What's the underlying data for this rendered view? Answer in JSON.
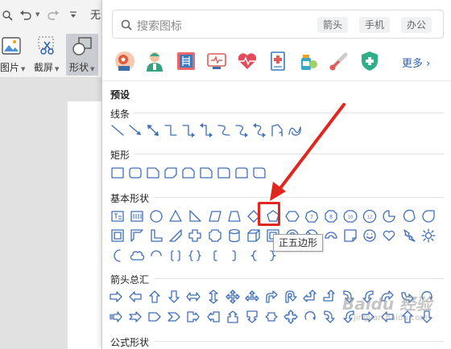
{
  "toolbar": {
    "picture_label": "图片",
    "screenshot_label": "截屏",
    "shapes_label": "形状"
  },
  "search": {
    "placeholder": "搜索图标",
    "tags": [
      "箭头",
      "手机",
      "办公"
    ]
  },
  "featured": {
    "icons": [
      "brain-gear-icon",
      "doctor-icon",
      "xray-icon",
      "medical-monitor-icon",
      "heart-pulse-icon",
      "medical-report-icon",
      "medicine-bottle-icon",
      "thermometer-icon",
      "health-shield-icon"
    ],
    "more_label": "更多"
  },
  "sections": {
    "preset": "预设",
    "lines": "线条",
    "rectangles": "矩形",
    "basic": "基本形状",
    "arrows": "箭头总汇",
    "formula": "公式形状"
  },
  "tooltip": "正五边形",
  "watermark": {
    "text": "Baidu 经验",
    "url": "jingyan.baidu.com"
  },
  "colors": {
    "shape_stroke": "#3f6fb7",
    "highlight": "#e0261f",
    "accent": "#2b64b7"
  }
}
